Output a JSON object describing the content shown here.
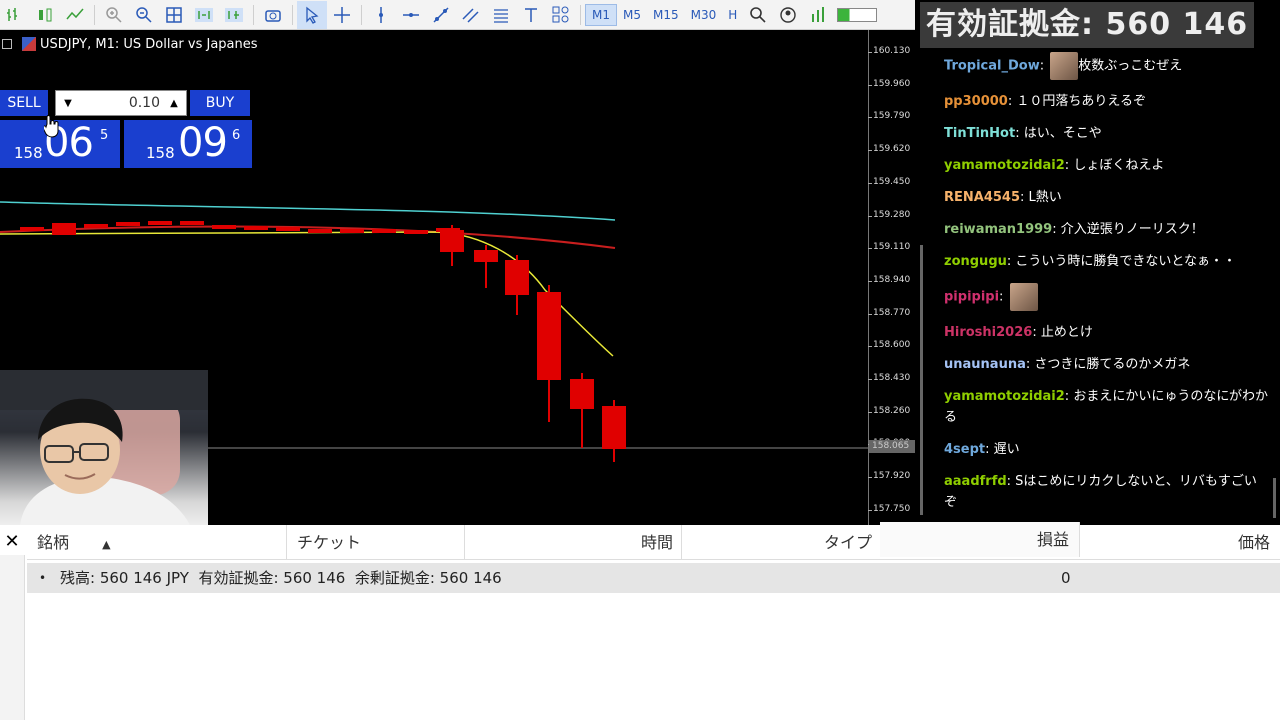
{
  "toolbar": {
    "timeframes": [
      "M1",
      "M5",
      "M15",
      "M30",
      "H"
    ],
    "active_timeframe": "M1"
  },
  "chart": {
    "title": "USDJPY, M1:  US Dollar vs Japanes",
    "price_labels": [
      "160.130",
      "159.960",
      "159.790",
      "159.620",
      "159.450",
      "159.280",
      "159.110",
      "158.940",
      "158.770",
      "158.600",
      "158.430",
      "158.260",
      "158.090",
      "157.920",
      "157.750"
    ],
    "current_price": "158.065"
  },
  "trade_panel": {
    "sell_label": "SELL",
    "buy_label": "BUY",
    "lot": "0.10",
    "sell_price": {
      "prefix": "158",
      "big": "06",
      "sup": "5"
    },
    "buy_price": {
      "prefix": "158",
      "big": "09",
      "sup": "6"
    }
  },
  "chat": {
    "header": "有効証拠金: 560 146",
    "messages": [
      {
        "user": "Tropical_Dow",
        "text": "枚数ぶっこむぜえ",
        "color": "#6fa8dc",
        "avatar": true
      },
      {
        "user": "pp30000",
        "text": "１０円落ちありえるぞ",
        "color": "#e69138",
        "avatar": false
      },
      {
        "user": "TinTinHot",
        "text": "はい、そこや",
        "color": "#7fe0d8",
        "avatar": false
      },
      {
        "user": "yamamotozidai2",
        "text": "しょぼくねえよ",
        "color": "#8fce00",
        "avatar": false
      },
      {
        "user": "RENA4545",
        "text": "L熱い",
        "color": "#f6b26b",
        "avatar": false
      },
      {
        "user": "reiwaman1999",
        "text": "介入逆張りノーリスク！",
        "color": "#93c47d",
        "avatar": false
      },
      {
        "user": "zongugu",
        "text": "こういう時に勝負できないとなぁ・・",
        "color": "#8fce00",
        "avatar": false
      },
      {
        "user": "pipipipi",
        "text": "",
        "color": "#d1306e",
        "avatar": true
      },
      {
        "user": "Hiroshi2026",
        "text": "止めとけ",
        "color": "#cc3366",
        "avatar": false
      },
      {
        "user": "unaunauna",
        "text": "さつきに勝てるのかメガネ",
        "color": "#a4c2f4",
        "avatar": false
      },
      {
        "user": "yamamotozidai2",
        "text": "おまえにかいにゅうのなにがわかる",
        "color": "#8fce00",
        "avatar": false
      },
      {
        "user": "4sept",
        "text": "遅い",
        "color": "#6fa8dc",
        "avatar": false
      },
      {
        "user": "aaadfrfd",
        "text": "Sはこめにリカクしないと、リバもすごいぞ",
        "color": "#8fce00",
        "avatar": false
      }
    ]
  },
  "terminal": {
    "columns": [
      "銘柄",
      "チケット",
      "時間",
      "タイプ",
      "損益",
      "価格"
    ],
    "balance_row": "残高: 560 146 JPY  有効証拠金: 560 146  余剰証拠金: 560 146",
    "profit": "0"
  },
  "colors": {
    "candle": "#e00000",
    "ma_yellow": "#e8e838",
    "ma_red": "#c81e1e",
    "ma_cyan": "#4fd0d0",
    "button_blue": "#1a3fcf"
  }
}
